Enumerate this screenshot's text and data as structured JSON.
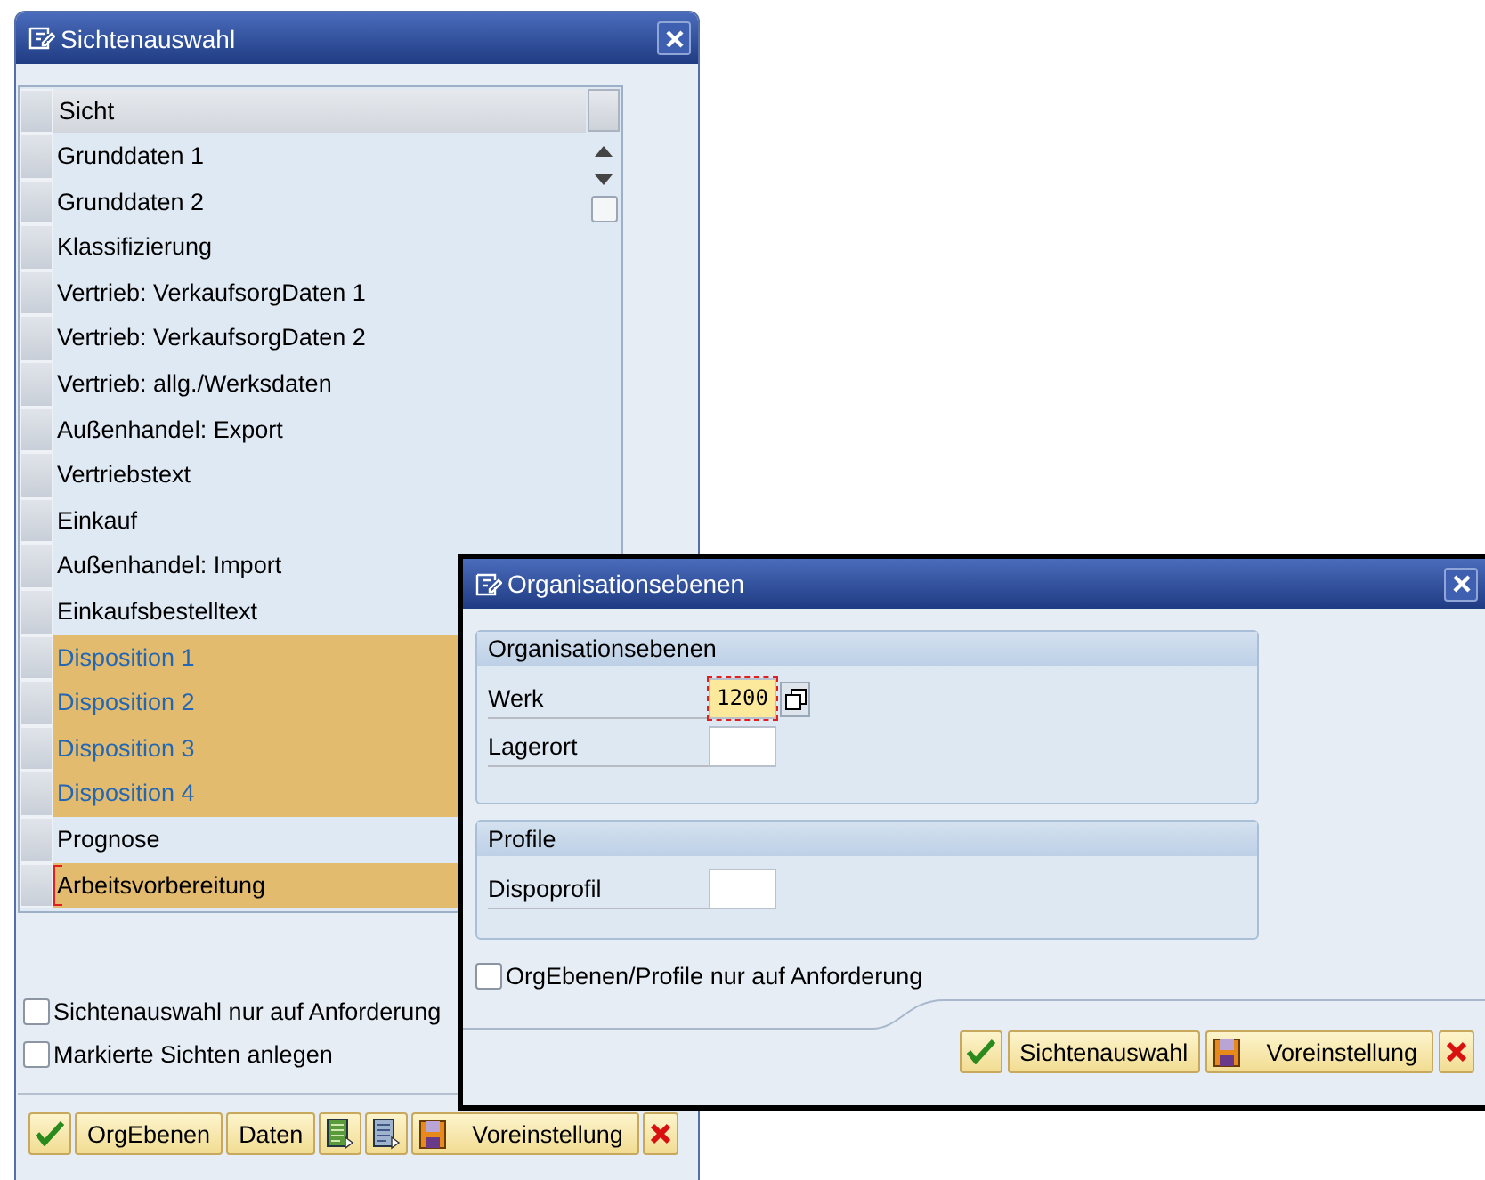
{
  "view_selection": {
    "title": "Sichtenauswahl",
    "column": "Sicht",
    "rows": [
      {
        "label": "Grunddaten 1",
        "selected": false,
        "focused": false
      },
      {
        "label": "Grunddaten 2",
        "selected": false,
        "focused": false
      },
      {
        "label": "Klassifizierung",
        "selected": false,
        "focused": false
      },
      {
        "label": "Vertrieb: VerkaufsorgDaten 1",
        "selected": false,
        "focused": false
      },
      {
        "label": "Vertrieb: VerkaufsorgDaten 2",
        "selected": false,
        "focused": false
      },
      {
        "label": "Vertrieb: allg./Werksdaten",
        "selected": false,
        "focused": false
      },
      {
        "label": "Außenhandel: Export",
        "selected": false,
        "focused": false
      },
      {
        "label": "Vertriebstext",
        "selected": false,
        "focused": false
      },
      {
        "label": "Einkauf",
        "selected": false,
        "focused": false
      },
      {
        "label": "Außenhandel: Import",
        "selected": false,
        "focused": false
      },
      {
        "label": "Einkaufsbestelltext",
        "selected": false,
        "focused": false
      },
      {
        "label": "Disposition 1",
        "selected": true,
        "focused": false
      },
      {
        "label": "Disposition 2",
        "selected": true,
        "focused": false
      },
      {
        "label": "Disposition 3",
        "selected": true,
        "focused": false
      },
      {
        "label": "Disposition 4",
        "selected": true,
        "focused": false
      },
      {
        "label": "Prognose",
        "selected": false,
        "focused": false
      },
      {
        "label": "Arbeitsvorbereitung",
        "selected": true,
        "focused": true
      }
    ],
    "options": [
      {
        "label": "Sichtenauswahl nur auf Anforderung",
        "checked": false
      },
      {
        "label": "Markierte Sichten anlegen",
        "checked": false
      }
    ],
    "buttons": [
      {
        "kind": "ok"
      },
      {
        "kind": "text",
        "label": "OrgEbenen"
      },
      {
        "kind": "text",
        "label": "Daten"
      },
      {
        "kind": "list"
      },
      {
        "kind": "doc"
      },
      {
        "kind": "save",
        "label": "Voreinstellung"
      },
      {
        "kind": "cancel"
      }
    ]
  },
  "org_levels": {
    "title": "Organisationsebenen",
    "groups": [
      {
        "title": "Organisationsebenen",
        "fields": [
          {
            "label": "Werk",
            "value": "1200",
            "focused": true,
            "help": true
          },
          {
            "label": "Lagerort",
            "focused": false,
            "help": false
          }
        ]
      },
      {
        "title": "Profile",
        "fields": [
          {
            "label": "Dispoprofil",
            "focused": false,
            "help": false
          }
        ]
      }
    ],
    "option": {
      "label": "OrgEbenen/Profile nur auf Anforderung",
      "checked": false
    },
    "buttons": [
      {
        "kind": "ok"
      },
      {
        "kind": "text",
        "label": "Sichtenauswahl"
      },
      {
        "kind": "save",
        "label": "Voreinstellung"
      },
      {
        "kind": "cancel"
      }
    ]
  }
}
